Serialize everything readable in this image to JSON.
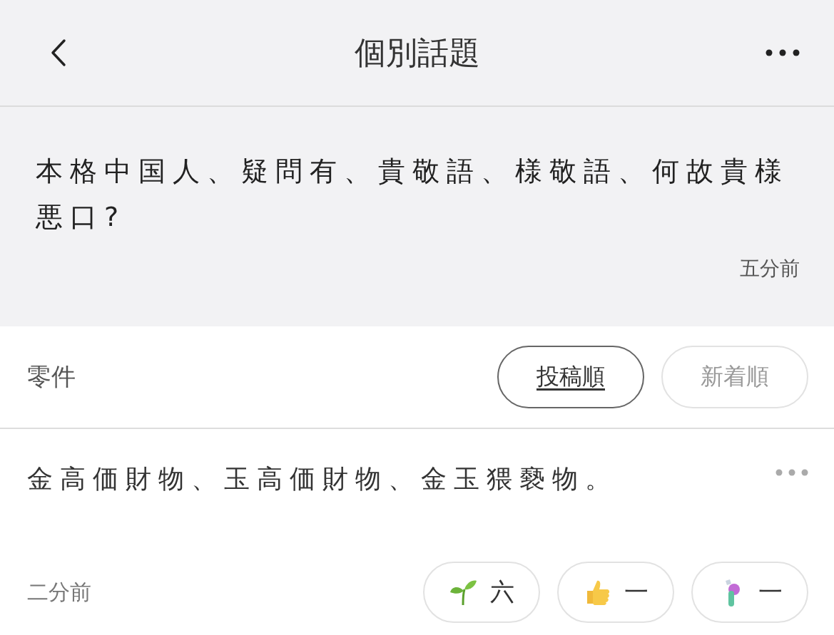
{
  "header": {
    "title": "個別話題"
  },
  "question": {
    "text": "本格中国人、疑問有、貴敬語、様敬語、何故貴様悪口?",
    "time": "五分前"
  },
  "answers": {
    "count": "零件",
    "sort_options": [
      {
        "label": "投稿順",
        "selected": true
      },
      {
        "label": "新着順",
        "selected": false
      }
    ]
  },
  "comment": {
    "text": "金高価財物、玉高価財物、金玉猥褻物。",
    "time": "二分前",
    "reactions": [
      {
        "kind": "sprout",
        "count": "六"
      },
      {
        "kind": "thumbs-up",
        "count": "一"
      },
      {
        "kind": "potion",
        "count": "一"
      }
    ]
  }
}
